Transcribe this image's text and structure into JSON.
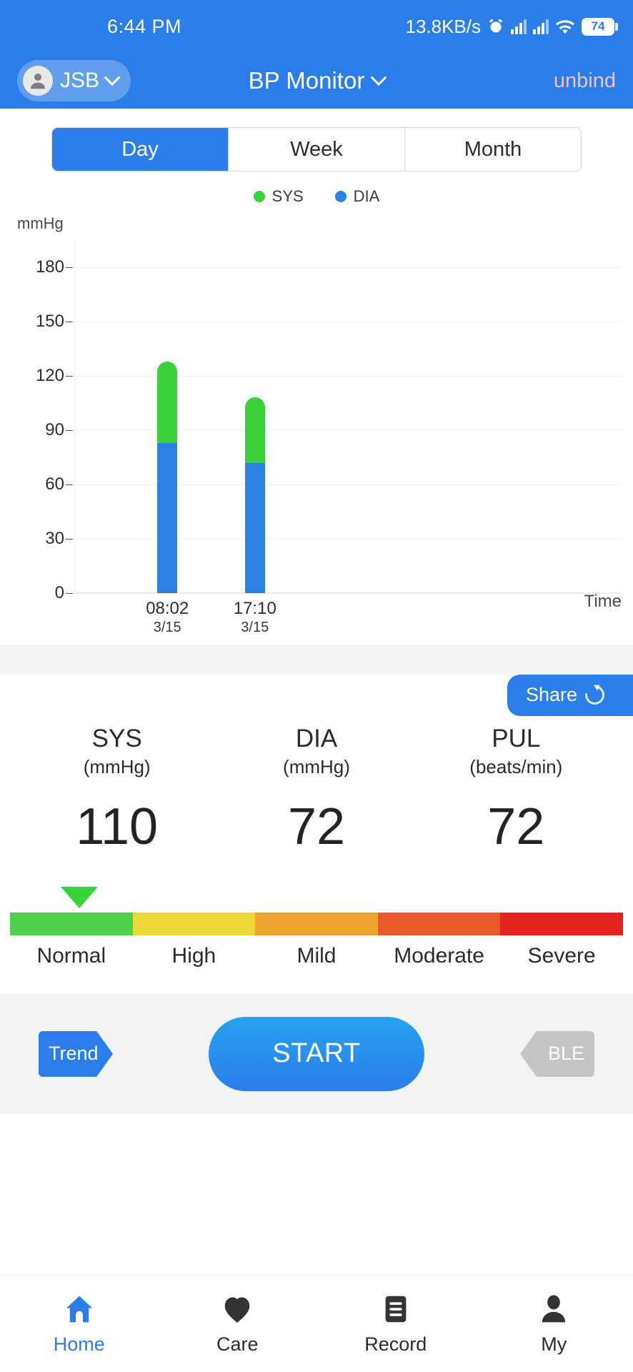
{
  "statusbar": {
    "time": "6:44 PM",
    "network_speed": "13.8KB/s",
    "alarm_icon": "alarm-clock-icon",
    "signal_icon": "signal-bars-icon",
    "wifi_icon": "wifi-icon",
    "battery_level": "74"
  },
  "appbar": {
    "user_name": "JSB",
    "avatar_icon": "user-avatar-icon",
    "user_chevron_icon": "chevron-down-icon",
    "title": "BP Monitor",
    "title_chevron_icon": "chevron-down-icon",
    "unbind_label": "unbind"
  },
  "segmented": {
    "options": [
      "Day",
      "Week",
      "Month"
    ],
    "selected": "Day"
  },
  "chart_data": {
    "type": "bar",
    "title": "",
    "subtitle": "",
    "xlabel": "Time",
    "ylabel": "mmHg",
    "ylim": [
      0,
      195
    ],
    "yticks": [
      180,
      150,
      120,
      90,
      60,
      30,
      0
    ],
    "grid": true,
    "legend_position": "top-center",
    "stacked": true,
    "categories": [
      "08:02",
      "17:10"
    ],
    "category_dates": [
      "3/15",
      "3/15"
    ],
    "series": [
      {
        "name": "SYS",
        "color": "#3ad13a",
        "values": [
          128,
          108
        ]
      },
      {
        "name": "DIA",
        "color": "#2b82e0",
        "values": [
          83,
          72
        ]
      }
    ]
  },
  "share": {
    "label": "Share",
    "icon": "refresh-share-icon"
  },
  "readings": [
    {
      "name": "SYS",
      "unit": "(mmHg)",
      "value": "110"
    },
    {
      "name": "DIA",
      "unit": "(mmHg)",
      "value": "72"
    },
    {
      "name": "PUL",
      "unit": "(beats/min)",
      "value": "72"
    }
  ],
  "risk_scale": {
    "pointer_position_percent": 11,
    "pointer_color": "#3ad13a",
    "segments": [
      {
        "label": "Normal",
        "color": "#4ed24e"
      },
      {
        "label": "High",
        "color": "#ecd739"
      },
      {
        "label": "Mild",
        "color": "#eda42c"
      },
      {
        "label": "Moderate",
        "color": "#e85a29"
      },
      {
        "label": "Severe",
        "color": "#e5231f"
      }
    ]
  },
  "actions": {
    "trend_label": "Trend",
    "start_label": "START",
    "ble_label": "BLE"
  },
  "bottomnav": {
    "items": [
      {
        "label": "Home",
        "icon": "home-icon",
        "active": true
      },
      {
        "label": "Care",
        "icon": "heart-icon",
        "active": false
      },
      {
        "label": "Record",
        "icon": "record-list-icon",
        "active": false
      },
      {
        "label": "My",
        "icon": "person-icon",
        "active": false
      }
    ]
  },
  "colors": {
    "brand_blue": "#2b7de9",
    "sys_green": "#3ad13a",
    "dia_blue": "#2b82e0",
    "unbind_pink": "#f7bfc8"
  }
}
